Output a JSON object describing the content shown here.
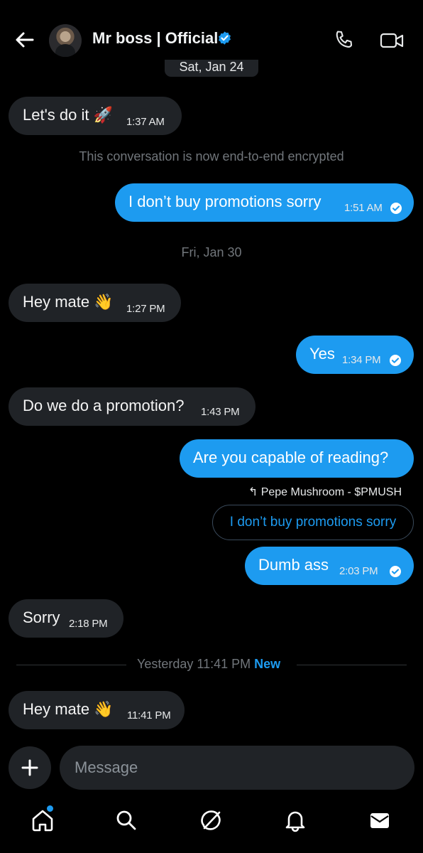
{
  "header": {
    "title": "Mr boss | Official",
    "back_icon": "arrow-left-icon",
    "verified_icon": "verified-badge-icon",
    "call_icon": "phone-icon",
    "video_icon": "video-camera-icon"
  },
  "conversation": {
    "date_separators": [
      "Sat, Jan 24",
      "Fri, Jan 30"
    ],
    "encryption_notice": "This conversation is now end-to-end encrypted",
    "messages": [
      {
        "direction": "incoming",
        "text": "Let's do it 🚀",
        "time": "1:37 AM"
      },
      {
        "direction": "outgoing",
        "text": "I don’t buy promotions sorry",
        "time": "1:51 AM",
        "status": "sent-check"
      },
      {
        "direction": "incoming",
        "text": "Hey mate 👋",
        "time": "1:27 PM"
      },
      {
        "direction": "outgoing",
        "text": "Yes",
        "time": "1:34 PM",
        "status": "sent-check"
      },
      {
        "direction": "incoming",
        "text": "Do we do a promotion?",
        "time": "1:43 PM"
      },
      {
        "direction": "outgoing",
        "text": "Are you capable of reading?",
        "time": ""
      },
      {
        "direction": "outgoing",
        "text": "Dumb ass",
        "time": "2:03 PM",
        "status": "sent-check"
      },
      {
        "direction": "incoming",
        "text": "Sorry",
        "time": "2:18 PM"
      },
      {
        "direction": "incoming",
        "text": "Hey mate 👋",
        "time": "11:41 PM"
      }
    ],
    "reply": {
      "label": "Pepe Mushroom - $PMUSH",
      "quoted_text": "I don’t buy promotions sorry"
    },
    "new_divider": {
      "text": "Yesterday 11:41 PM",
      "badge": "New"
    }
  },
  "composer": {
    "placeholder": "Message",
    "add_icon": "plus-icon"
  },
  "bottom_nav": {
    "items": [
      "home-icon",
      "search-icon",
      "grok-icon",
      "notifications-bell-icon",
      "messages-envelope-icon"
    ],
    "accent": "#1d9bf0"
  },
  "colors": {
    "background": "#000000",
    "incoming_bubble": "#202327",
    "outgoing_bubble": "#1d9bf0",
    "muted_text": "#71767b"
  }
}
